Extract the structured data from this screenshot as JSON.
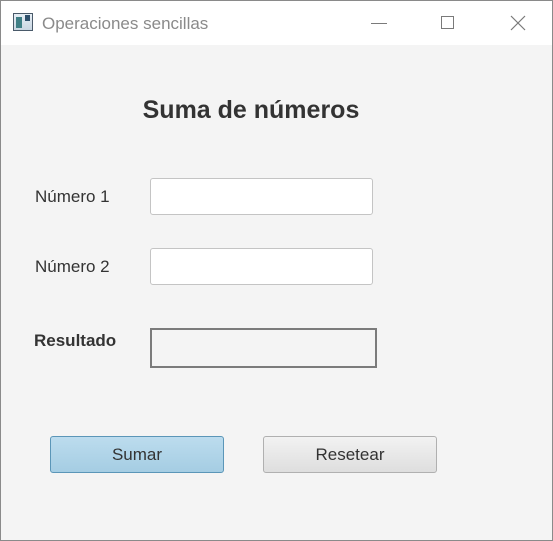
{
  "window": {
    "title": "Operaciones sencillas",
    "icon": "java-app-icon",
    "controls": {
      "minimize": "minimize-icon",
      "maximize": "maximize-icon",
      "close": "close-icon"
    }
  },
  "form": {
    "heading": "Suma de números",
    "numero1": {
      "label": "Número 1",
      "value": ""
    },
    "numero2": {
      "label": "Número 2",
      "value": ""
    },
    "resultado": {
      "label": "Resultado",
      "value": ""
    }
  },
  "buttons": {
    "sumar": "Sumar",
    "resetear": "Resetear"
  },
  "colors": {
    "primary_button": "#a5cde3",
    "background": "#f4f4f4"
  }
}
